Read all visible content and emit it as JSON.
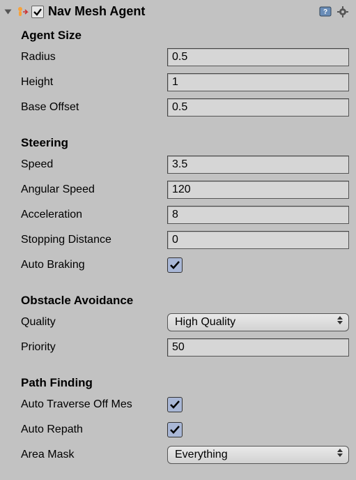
{
  "header": {
    "title": "Nav Mesh Agent",
    "enabled": true
  },
  "sections": {
    "agentSize": {
      "heading": "Agent Size",
      "radius": {
        "label": "Radius",
        "value": "0.5"
      },
      "height": {
        "label": "Height",
        "value": "1"
      },
      "baseOffset": {
        "label": "Base Offset",
        "value": "0.5"
      }
    },
    "steering": {
      "heading": "Steering",
      "speed": {
        "label": "Speed",
        "value": "3.5"
      },
      "angularSpeed": {
        "label": "Angular Speed",
        "value": "120"
      },
      "acceleration": {
        "label": "Acceleration",
        "value": "8"
      },
      "stoppingDistance": {
        "label": "Stopping Distance",
        "value": "0"
      },
      "autoBraking": {
        "label": "Auto Braking",
        "checked": true
      }
    },
    "obstacleAvoidance": {
      "heading": "Obstacle Avoidance",
      "quality": {
        "label": "Quality",
        "value": "High Quality"
      },
      "priority": {
        "label": "Priority",
        "value": "50"
      }
    },
    "pathFinding": {
      "heading": "Path Finding",
      "autoTraverse": {
        "label": "Auto Traverse Off Mes",
        "checked": true
      },
      "autoRepath": {
        "label": "Auto Repath",
        "checked": true
      },
      "areaMask": {
        "label": "Area Mask",
        "value": "Everything"
      }
    }
  }
}
